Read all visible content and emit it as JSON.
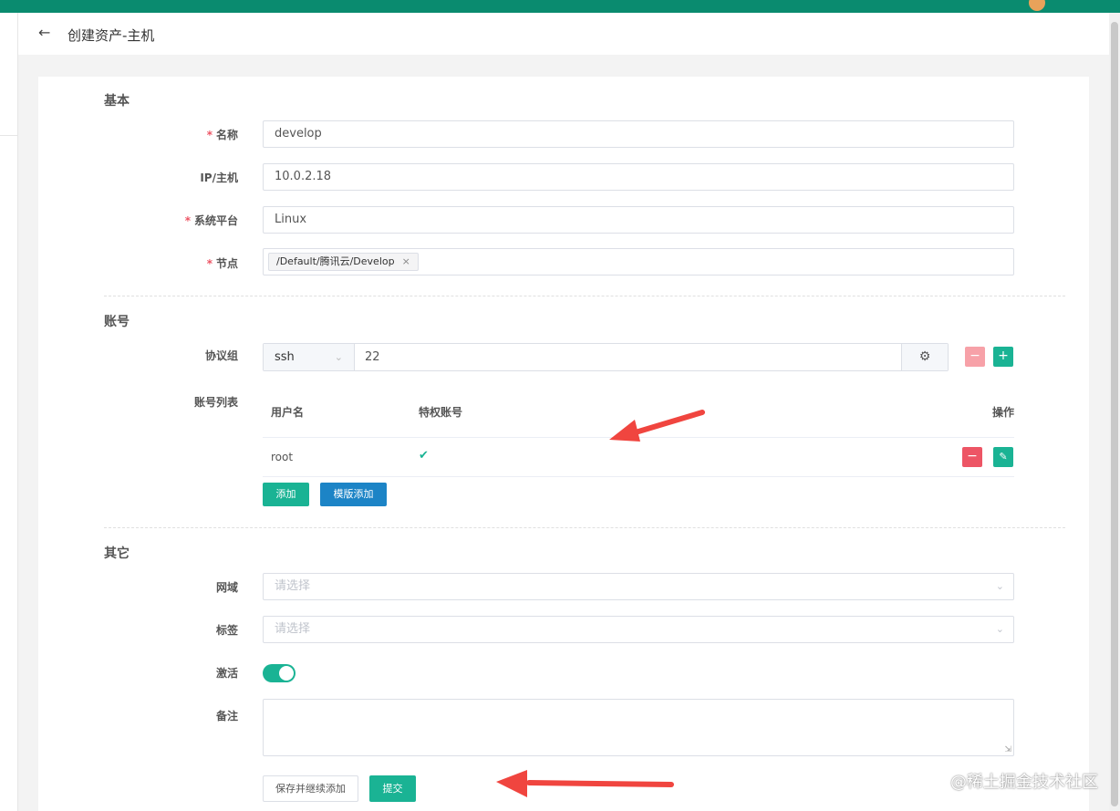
{
  "header": {
    "back_icon": "arrow-left-icon",
    "title": "创建资产-主机"
  },
  "basic": {
    "section_title": "基本",
    "name": {
      "label": "名称",
      "value": "develop",
      "required": true
    },
    "ip": {
      "label": "IP/主机",
      "value": "10.0.2.18",
      "required": false
    },
    "platform": {
      "label": "系统平台",
      "value": "Linux",
      "required": true
    },
    "node": {
      "label": "节点",
      "tag": "/Default/腾讯云/Develop",
      "tag_close": "×",
      "required": true
    }
  },
  "account": {
    "section_title": "账号",
    "protocol": {
      "label": "协议组",
      "protocol": "ssh",
      "port": "22"
    },
    "list": {
      "label": "账号列表",
      "columns": [
        "用户名",
        "特权账号",
        "操作"
      ],
      "rows": [
        {
          "username": "root",
          "privileged": true
        }
      ]
    },
    "add_button": "添加",
    "template_add_button": "模版添加"
  },
  "other": {
    "section_title": "其它",
    "domain": {
      "label": "网域",
      "placeholder": "请选择"
    },
    "labels": {
      "label": "标签",
      "placeholder": "请选择"
    },
    "active": {
      "label": "激活",
      "value": true
    },
    "comment": {
      "label": "备注",
      "value": ""
    }
  },
  "actions": {
    "save_continue": "保存并继续添加",
    "submit": "提交"
  },
  "watermark": "@稀土掘金技术社区",
  "colors": {
    "topbar": "#0a8b6f",
    "primary": "#1ab394",
    "danger": "#ed5565",
    "info": "#1c84c6",
    "arrow": "#f0453f"
  }
}
